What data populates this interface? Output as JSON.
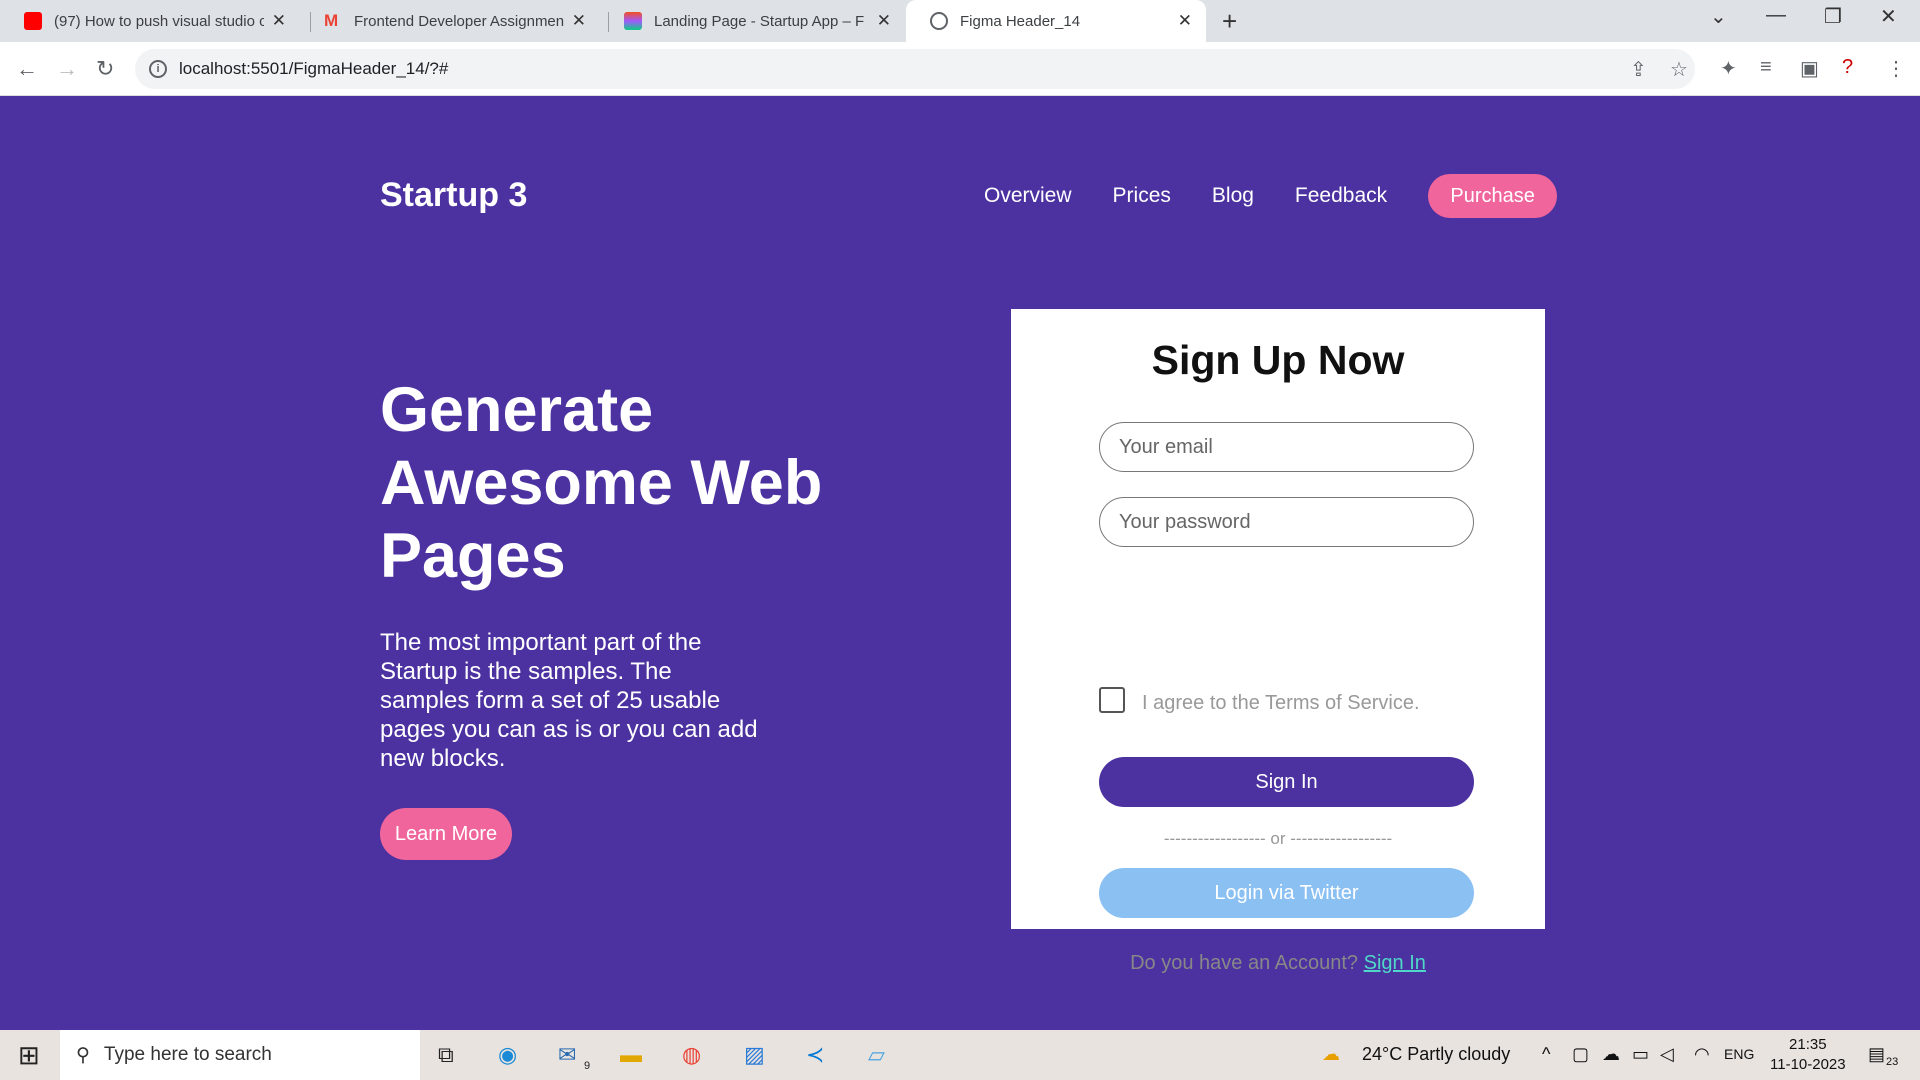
{
  "browser": {
    "tabs": [
      {
        "title": "(97) How to push visual studio c",
        "icon": "youtube-icon",
        "color": "#ff0000"
      },
      {
        "title": "Frontend Developer Assignment",
        "icon": "gmail-icon",
        "color": "#ea4335"
      },
      {
        "title": "Landing Page - Startup App – Fig",
        "icon": "figma-icon",
        "color": "#a259ff"
      },
      {
        "title": "Figma Header_14",
        "icon": "globe-icon",
        "color": "#5f6368"
      }
    ],
    "url": "localhost:5501/FigmaHeader_14/?#"
  },
  "page": {
    "brand": "Startup 3",
    "nav": [
      "Overview",
      "Prices",
      "Blog",
      "Feedback"
    ],
    "purchase_label": "Purchase",
    "hero_title": "Generate Awesome Web Pages",
    "hero_text": "The most important part of the Startup is the samples. The samples form a set of 25 usable pages you can as is or you can add new blocks.",
    "learn_more_label": "Learn More",
    "colors": {
      "background": "#4c32a0",
      "accent": "#f0659c",
      "twitter": "#8bc0f3",
      "link": "#4fd8c8"
    }
  },
  "signup": {
    "title": "Sign Up Now",
    "email_placeholder": "Your email",
    "password_placeholder": "Your password",
    "terms_label": "I agree to the Terms of Service.",
    "signin_label": "Sign In",
    "or_divider": "------------------ or ------------------",
    "twitter_label": "Login via Twitter",
    "account_prompt": "Do you have an Account?",
    "account_link": "Sign In"
  },
  "taskbar": {
    "search_placeholder": "Type here to search",
    "weather": "24°C  Partly cloudy",
    "language": "ENG",
    "time": "21:35",
    "date": "11-10-2023",
    "notification_count": "23",
    "mail_badge": "9"
  }
}
